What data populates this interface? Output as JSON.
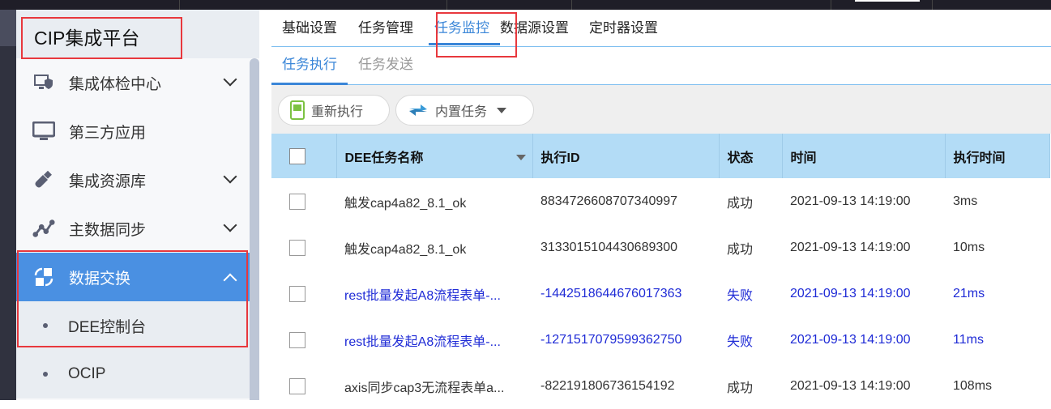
{
  "app_title": "CIP集成平台",
  "sidebar": {
    "items": [
      {
        "label": "集成体检中心",
        "icon": "shield-monitor-icon",
        "expandable": true
      },
      {
        "label": "第三方应用",
        "icon": "monitor-icon",
        "expandable": false
      },
      {
        "label": "集成资源库",
        "icon": "usb-icon",
        "expandable": true
      },
      {
        "label": "主数据同步",
        "icon": "line-chart-icon",
        "expandable": true
      },
      {
        "label": "数据交换",
        "icon": "exchange-icon",
        "expandable": true,
        "active": true
      }
    ],
    "sub_items": [
      {
        "label": "DEE控制台",
        "selected": true
      },
      {
        "label": "OCIP"
      }
    ]
  },
  "tabs": [
    "基础设置",
    "任务管理",
    "任务监控",
    "数据源设置",
    "定时器设置"
  ],
  "active_tab": "任务监控",
  "subtabs": [
    "任务执行",
    "任务发送"
  ],
  "toolbar": {
    "rerun": "重新执行",
    "builtin": "内置任务"
  },
  "table": {
    "columns": [
      "DEE任务名称",
      "执行ID",
      "状态",
      "时间",
      "执行时间"
    ],
    "rows": [
      {
        "name": "触发cap4a82_8.1_ok",
        "id": "8834726608707340997",
        "status": "成功",
        "time": "2021-09-13 14:19:00",
        "duration": "3ms"
      },
      {
        "name": "触发cap4a82_8.1_ok",
        "id": "3133015104430689300",
        "status": "成功",
        "time": "2021-09-13 14:19:00",
        "duration": "10ms"
      },
      {
        "name": "rest批量发起A8流程表单-...",
        "id": "-1442518644676017363",
        "status": "失败",
        "time": "2021-09-13 14:19:00",
        "duration": "21ms"
      },
      {
        "name": "rest批量发起A8流程表单-...",
        "id": "-1271517079599362750",
        "status": "失败",
        "time": "2021-09-13 14:19:00",
        "duration": "11ms"
      },
      {
        "name": "axis同步cap3无流程表单a...",
        "id": "-822191806736154192",
        "status": "成功",
        "time": "2021-09-13 14:19:00",
        "duration": "108ms"
      }
    ]
  }
}
